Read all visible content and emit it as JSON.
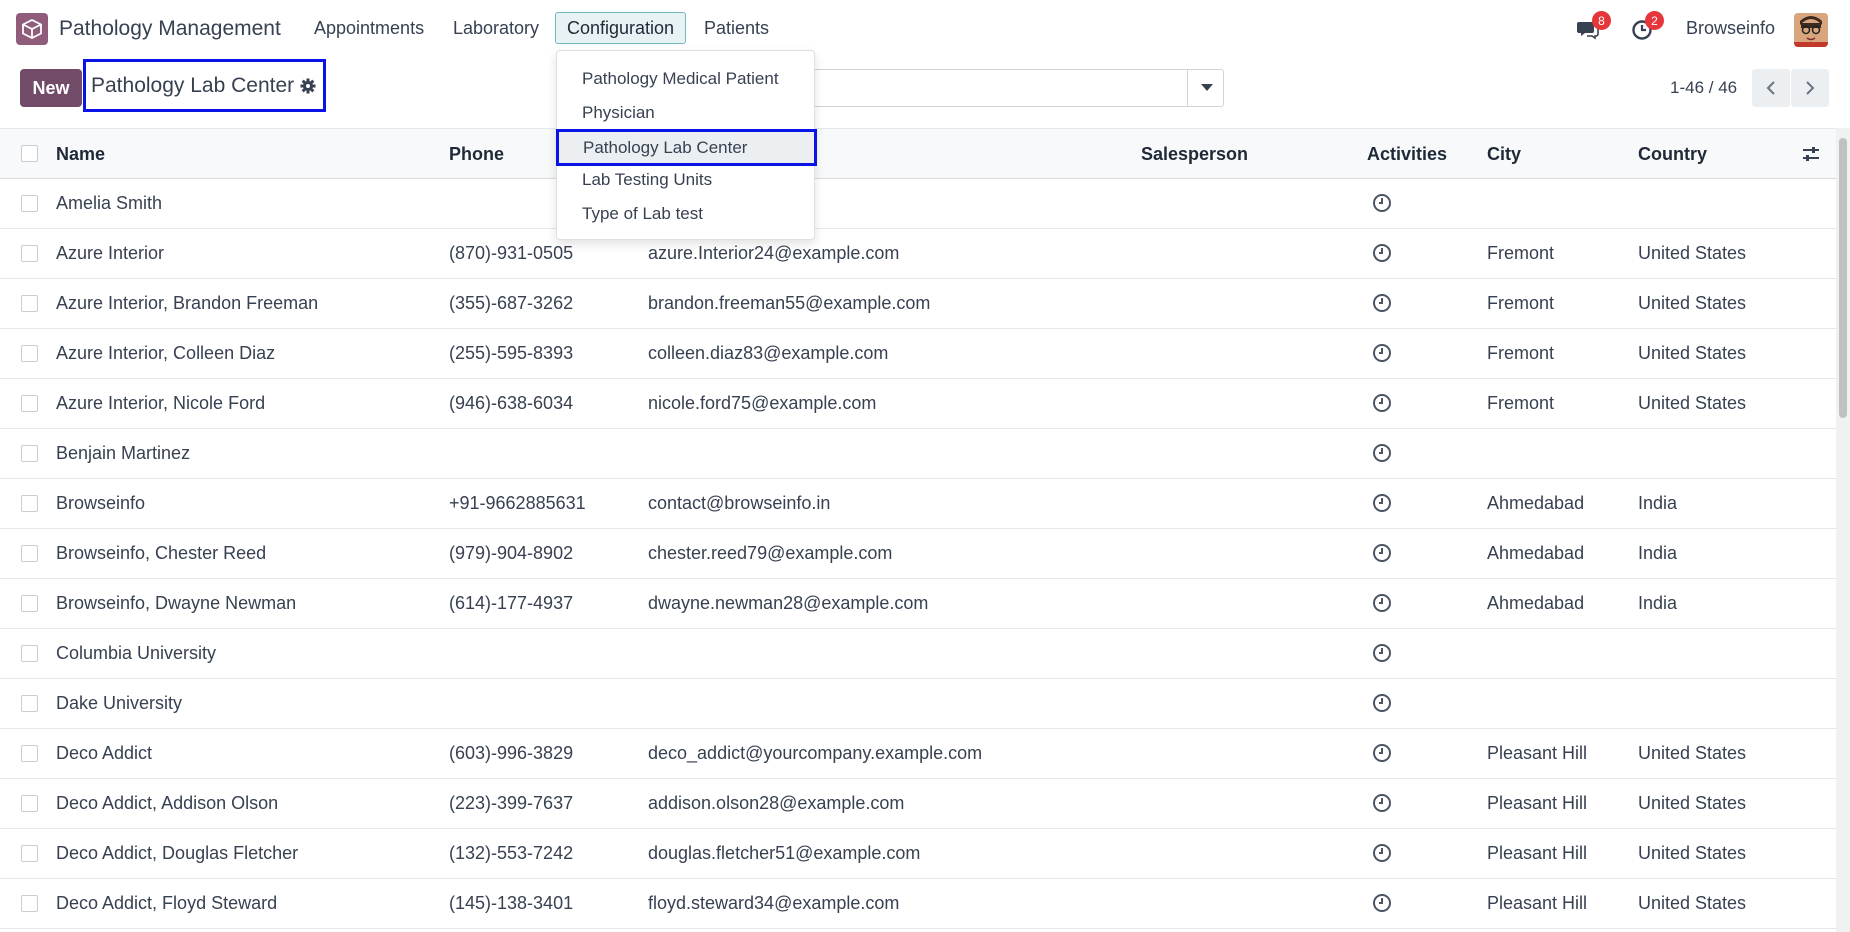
{
  "navbar": {
    "app_name": "Pathology Management",
    "menu": [
      {
        "label": "Appointments"
      },
      {
        "label": "Laboratory"
      },
      {
        "label": "Configuration"
      },
      {
        "label": "Patients"
      }
    ],
    "messages_badge": "8",
    "activities_badge": "2",
    "user_name": "Browseinfo"
  },
  "control_panel": {
    "new_label": "New",
    "breadcrumb": "Pathology Lab Center",
    "pager": "1-46 / 46"
  },
  "dropdown": {
    "items": [
      {
        "label": "Pathology Medical Patient"
      },
      {
        "label": "Physician"
      },
      {
        "label": "Pathology Lab Center"
      },
      {
        "label": "Lab Testing Units"
      },
      {
        "label": "Type of Lab test"
      }
    ]
  },
  "table": {
    "headers": {
      "name": "Name",
      "phone": "Phone",
      "salesperson": "Salesperson",
      "activities": "Activities",
      "city": "City",
      "country": "Country"
    },
    "rows": [
      {
        "name": "Amelia Smith",
        "phone": "",
        "email": "",
        "city": "",
        "country": ""
      },
      {
        "name": "Azure Interior",
        "phone": "(870)-931-0505",
        "email": "azure.Interior24@example.com",
        "city": "Fremont",
        "country": "United States"
      },
      {
        "name": "Azure Interior, Brandon Freeman",
        "phone": "(355)-687-3262",
        "email": "brandon.freeman55@example.com",
        "city": "Fremont",
        "country": "United States"
      },
      {
        "name": "Azure Interior, Colleen Diaz",
        "phone": "(255)-595-8393",
        "email": "colleen.diaz83@example.com",
        "city": "Fremont",
        "country": "United States"
      },
      {
        "name": "Azure Interior, Nicole Ford",
        "phone": "(946)-638-6034",
        "email": "nicole.ford75@example.com",
        "city": "Fremont",
        "country": "United States"
      },
      {
        "name": "Benjain Martinez",
        "phone": "",
        "email": "",
        "city": "",
        "country": ""
      },
      {
        "name": "Browseinfo",
        "phone": "+91-9662885631",
        "email": "contact@browseinfo.in",
        "city": "Ahmedabad",
        "country": "India"
      },
      {
        "name": "Browseinfo, Chester Reed",
        "phone": "(979)-904-8902",
        "email": "chester.reed79@example.com",
        "city": "Ahmedabad",
        "country": "India"
      },
      {
        "name": "Browseinfo, Dwayne Newman",
        "phone": "(614)-177-4937",
        "email": "dwayne.newman28@example.com",
        "city": "Ahmedabad",
        "country": "India"
      },
      {
        "name": "Columbia University",
        "phone": "",
        "email": "",
        "city": "",
        "country": ""
      },
      {
        "name": "Dake University",
        "phone": "",
        "email": "",
        "city": "",
        "country": ""
      },
      {
        "name": "Deco Addict",
        "phone": "(603)-996-3829",
        "email": "deco_addict@yourcompany.example.com",
        "city": "Pleasant Hill",
        "country": "United States"
      },
      {
        "name": "Deco Addict, Addison Olson",
        "phone": "(223)-399-7637",
        "email": "addison.olson28@example.com",
        "city": "Pleasant Hill",
        "country": "United States"
      },
      {
        "name": "Deco Addict, Douglas Fletcher",
        "phone": "(132)-553-7242",
        "email": "douglas.fletcher51@example.com",
        "city": "Pleasant Hill",
        "country": "United States"
      },
      {
        "name": "Deco Addict, Floyd Steward",
        "phone": "(145)-138-3401",
        "email": "floyd.steward34@example.com",
        "city": "Pleasant Hill",
        "country": "United States"
      }
    ]
  },
  "colors": {
    "brand": "#714b67",
    "highlight_border": "#0a14e6",
    "badge": "#e5363b",
    "active_menu_bg": "#e6f2f3"
  }
}
